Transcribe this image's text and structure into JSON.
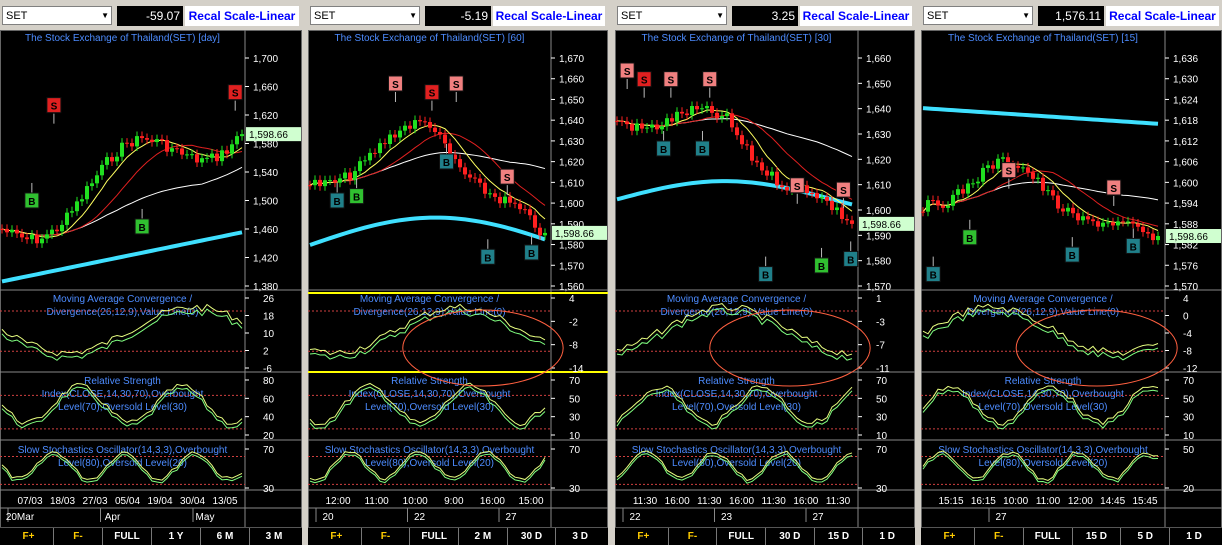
{
  "panels": [
    {
      "symbol": "SET",
      "change": "-59.07",
      "recal": "Recal Scale-Linear",
      "title": "The Stock Exchange of Thailand(SET) [day]",
      "last": "1,598.66",
      "price_ticks": [
        "1,700",
        "1,660",
        "1,620",
        "1,580",
        "1,540",
        "1,500",
        "1,460",
        "1,420",
        "1,380"
      ],
      "macd_title": [
        "Moving Average Convergence /",
        "Divergence(26,12,9),Value Line(0)"
      ],
      "macd_ticks": [
        "26",
        "18",
        "10",
        "2",
        "-6"
      ],
      "rsi_title": [
        "Relative Strength",
        "Index(CLOSE,14,30,70),Overbought",
        "Level(70),Oversold Level(30)"
      ],
      "rsi_ticks": [
        "80",
        "60",
        "40",
        "20"
      ],
      "stoch_title": [
        "Slow Stochastics Oscillator(14,3,3),Overbought",
        "Level(80),Oversold Level(20)"
      ],
      "stoch_ticks": [
        "70",
        "30"
      ],
      "time_labels": [
        "07/03",
        "18/03",
        "27/03",
        "05/04",
        "19/04",
        "30/04",
        "13/05"
      ],
      "bottom_labels": [
        "20Mar",
        "Apr",
        "May"
      ],
      "nav": [
        "F+",
        "F-",
        "FULL",
        "1 Y",
        "6 M",
        "3 M"
      ]
    },
    {
      "symbol": "SET",
      "change": "-5.19",
      "recal": "Recal Scale-Linear",
      "title": "The Stock Exchange of Thailand(SET) [60]",
      "last": "1,598.66",
      "price_ticks": [
        "1,670",
        "1,660",
        "1,650",
        "1,640",
        "1,630",
        "1,620",
        "1,610",
        "1,600",
        "1,590",
        "1,580",
        "1,570",
        "1,560"
      ],
      "macd_title": [
        "Moving Average Convergence /",
        "Divergence(26,12,9),Value Line(0)"
      ],
      "macd_ticks": [
        "4",
        "-2",
        "-8",
        "-14"
      ],
      "rsi_title": [
        "Relative Strength",
        "Index(CLOSE,14,30,70),Overbought",
        "Level(70),Oversold Level(30)"
      ],
      "rsi_ticks": [
        "70",
        "50",
        "30",
        "10"
      ],
      "stoch_title": [
        "Slow Stochastics Oscillator(14,3,3),Overbought",
        "Level(80),Oversold Level(20)"
      ],
      "stoch_ticks": [
        "70",
        "30"
      ],
      "time_labels": [
        "12:00",
        "11:00",
        "10:00",
        "9:00",
        "16:00",
        "15:00"
      ],
      "bottom_labels": [
        "20",
        "22",
        "27"
      ],
      "nav": [
        "F+",
        "F-",
        "FULL",
        "2 M",
        "30 D",
        "3 D"
      ]
    },
    {
      "symbol": "SET",
      "change": "3.25",
      "recal": "Recal Scale-Linear",
      "title": "The Stock Exchange of Thailand(SET) [30]",
      "last": "1,598.66",
      "price_ticks": [
        "1,660",
        "1,650",
        "1,640",
        "1,630",
        "1,620",
        "1,610",
        "1,600",
        "1,590",
        "1,580",
        "1,570"
      ],
      "macd_title": [
        "Moving Average Convergence /",
        "Divergence(26,12,9),Value Line(0)"
      ],
      "macd_ticks": [
        "1",
        "-3",
        "-7",
        "-11"
      ],
      "rsi_title": [
        "Relative Strength",
        "Index(CLOSE,14,30,70),Overbought",
        "Level(70),Oversold Level(30)"
      ],
      "rsi_ticks": [
        "70",
        "50",
        "30",
        "10"
      ],
      "stoch_title": [
        "Slow Stochastics Oscillator(14,3,3),Overbought",
        "Level(80),Oversold Level(20)"
      ],
      "stoch_ticks": [
        "70",
        "30"
      ],
      "time_labels": [
        "11:30",
        "16:00",
        "11:30",
        "16:00",
        "11:30",
        "16:00",
        "11:30"
      ],
      "bottom_labels": [
        "22",
        "23",
        "27"
      ],
      "nav": [
        "F+",
        "F-",
        "FULL",
        "30 D",
        "15 D",
        "1 D"
      ]
    },
    {
      "symbol": "SET",
      "change": "1,576.11",
      "recal": "Recal Scale-Linear",
      "title": "The Stock Exchange of Thailand(SET) [15]",
      "last": "1,598.66",
      "price_ticks": [
        "1,636",
        "1,630",
        "1,624",
        "1,618",
        "1,612",
        "1,606",
        "1,600",
        "1,594",
        "1,588",
        "1,582",
        "1,576",
        "1,570"
      ],
      "macd_title": [
        "Moving Average Convergence /",
        "Divergence(26,12,9),Value Line(0)"
      ],
      "macd_ticks": [
        "4",
        "0",
        "-4",
        "-8",
        "-12"
      ],
      "rsi_title": [
        "Relative Strength",
        "Index(CLOSE,14,30,70),Overbought",
        "Level(70),Oversold Level(30)"
      ],
      "rsi_ticks": [
        "70",
        "50",
        "30",
        "10"
      ],
      "stoch_title": [
        "Slow Stochastics Oscillator(14,3,3),Overbought",
        "Level(80),Oversold Level(20)"
      ],
      "stoch_ticks": [
        "50",
        "20"
      ],
      "time_labels": [
        "15:15",
        "16:15",
        "10:00",
        "11:00",
        "12:00",
        "14:45",
        "15:45"
      ],
      "bottom_labels": [
        "27"
      ],
      "nav": [
        "F+",
        "F-",
        "FULL",
        "15 D",
        "5 D",
        "1 D"
      ]
    }
  ]
}
